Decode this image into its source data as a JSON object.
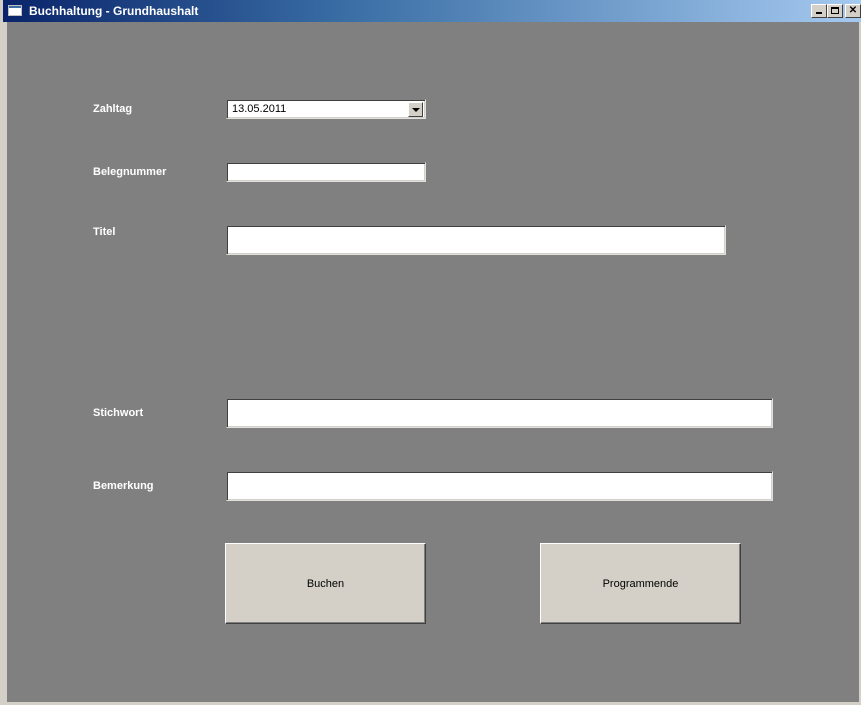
{
  "window": {
    "title": "Buchhaltung - Grundhaushalt",
    "icon": "window-app-icon",
    "controls": {
      "minimize": "minimize-icon",
      "maximize": "maximize-icon",
      "close": "close-icon",
      "close_glyph": "✕"
    }
  },
  "form": {
    "zahltag": {
      "label": "Zahltag",
      "value": "13.05.2011"
    },
    "belegnummer": {
      "label": "Belegnummer",
      "value": ""
    },
    "titel": {
      "label": "Titel",
      "value": ""
    },
    "stichwort": {
      "label": "Stichwort",
      "value": ""
    },
    "bemerkung": {
      "label": "Bemerkung",
      "value": ""
    }
  },
  "buttons": {
    "buchen": "Buchen",
    "programmende": "Programmende"
  },
  "colors": {
    "client_background": "#808080",
    "label_text": "#ffffff",
    "button_face": "#d4d0c8",
    "titlebar_start": "#0a246a",
    "titlebar_end": "#a6caf0"
  }
}
